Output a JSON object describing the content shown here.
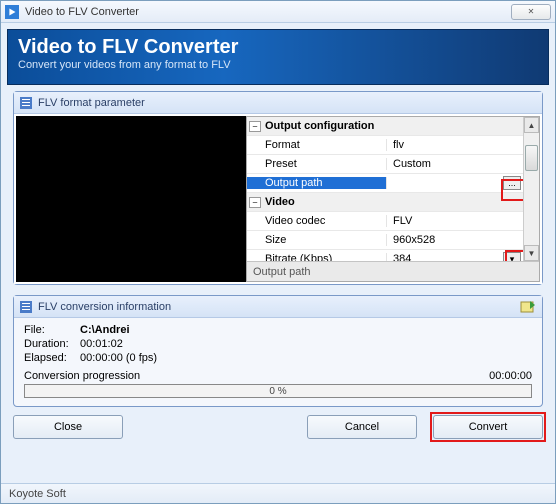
{
  "window": {
    "title": "Video to FLV Converter",
    "close_glyph": "✕"
  },
  "banner": {
    "title": "Video to FLV Converter",
    "subtitle": "Convert your videos from any format to FLV"
  },
  "param_panel": {
    "heading": "FLV format parameter"
  },
  "grid": {
    "sections": [
      {
        "name": "Output configuration",
        "rows": [
          {
            "label": "Format",
            "value": "flv"
          },
          {
            "label": "Preset",
            "value": "Custom"
          },
          {
            "label": "Output path",
            "value": "",
            "selected": true,
            "browse": true
          }
        ]
      },
      {
        "name": "Video",
        "rows": [
          {
            "label": "Video codec",
            "value": "FLV"
          },
          {
            "label": "Size",
            "value": "960x528"
          },
          {
            "label": "Bitrate (Kbps)",
            "value": "384",
            "dropdown": true
          }
        ]
      }
    ],
    "footer": "Output path",
    "browse_label": "...",
    "expander_glyph": "–",
    "dropdown_glyph": "▾"
  },
  "info_panel": {
    "heading": "FLV conversion information",
    "file_label": "File:",
    "file_value": "C:\\Andrei",
    "duration_label": "Duration:",
    "duration_value": "00:01:02",
    "elapsed_label": "Elapsed:",
    "elapsed_value": "00:00:00 (0 fps)",
    "progress_label": "Conversion progression",
    "progress_time": "00:00:00",
    "progress_pct": "0 %"
  },
  "buttons": {
    "close": "Close",
    "cancel": "Cancel",
    "convert": "Convert"
  },
  "statusbar": {
    "text": "Koyote Soft"
  }
}
